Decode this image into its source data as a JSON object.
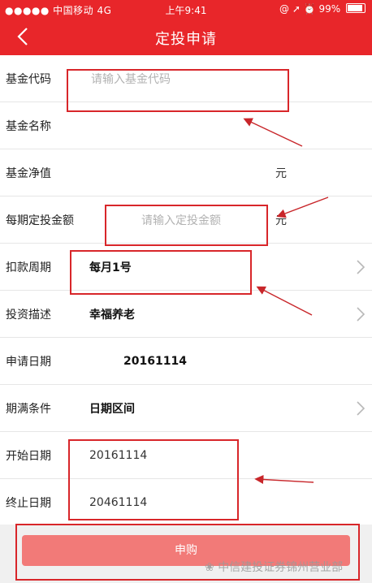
{
  "status_bar": {
    "carrier": "●●●●● 中国移动  4G",
    "time": "上午9:41",
    "indicators": "@ ➚ ⏰ 99%"
  },
  "nav": {
    "title": "定投申请",
    "back_icon": "chevron-left-icon"
  },
  "form": {
    "fund_code": {
      "label": "基金代码",
      "placeholder": "请输入基金代码"
    },
    "fund_name": {
      "label": "基金名称",
      "value": ""
    },
    "fund_nav": {
      "label": "基金净值",
      "unit": "元"
    },
    "amount": {
      "label": "每期定投金额",
      "placeholder": "请输入定投金额",
      "unit": "元"
    },
    "debit_cycle": {
      "label": "扣款周期",
      "value": "每月1号"
    },
    "description": {
      "label": "投资描述",
      "value": "幸福养老"
    },
    "apply_date": {
      "label": "申请日期",
      "value": "20161114"
    },
    "end_condition": {
      "label": "期满条件",
      "value": "日期区间"
    },
    "start_date": {
      "label": "开始日期",
      "value": "20161114"
    },
    "end_date": {
      "label": "终止日期",
      "value": "20461114"
    }
  },
  "submit_label": "申购",
  "watermark": "中信建投证券锦州营业部",
  "colors": {
    "brand_red": "#e8262a",
    "button": "#f27a78",
    "annotation": "#d8262a"
  }
}
